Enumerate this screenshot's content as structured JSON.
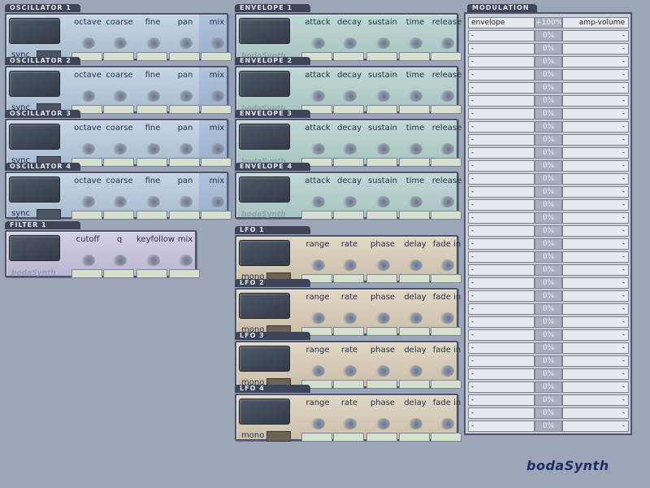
{
  "oscillators": [
    {
      "title": "OSCILLATOR 1",
      "sync_label": "sync",
      "knobs": [
        "octave",
        "coarse",
        "fine",
        "pan",
        "mix"
      ]
    },
    {
      "title": "OSCILLATOR 2",
      "sync_label": "sync",
      "knobs": [
        "octave",
        "coarse",
        "fine",
        "pan",
        "mix"
      ]
    },
    {
      "title": "OSCILLATOR 3",
      "sync_label": "sync",
      "knobs": [
        "octave",
        "coarse",
        "fine",
        "pan",
        "mix"
      ]
    },
    {
      "title": "OSCILLATOR 4",
      "sync_label": "sync",
      "knobs": [
        "octave",
        "coarse",
        "fine",
        "pan",
        "mix"
      ]
    }
  ],
  "envelopes": [
    {
      "title": "ENVELOPE 1",
      "knobs": [
        "attack",
        "decay",
        "sustain",
        "time",
        "release"
      ]
    },
    {
      "title": "ENVELOPE 2",
      "knobs": [
        "attack",
        "decay",
        "sustain",
        "time",
        "release"
      ]
    },
    {
      "title": "ENVELOPE 3",
      "knobs": [
        "attack",
        "decay",
        "sustain",
        "time",
        "release"
      ]
    },
    {
      "title": "ENVELOPE 4",
      "knobs": [
        "attack",
        "decay",
        "sustain",
        "time",
        "release"
      ]
    }
  ],
  "filter": {
    "title": "FILTER 1",
    "knobs": [
      "cutoff",
      "q",
      "keyfollow",
      "mix"
    ]
  },
  "lfos": [
    {
      "title": "LFO 1",
      "mono_label": "mono",
      "knobs": [
        "range",
        "rate",
        "phase",
        "delay",
        "fade in"
      ]
    },
    {
      "title": "LFO 2",
      "mono_label": "mono",
      "knobs": [
        "range",
        "rate",
        "phase",
        "delay",
        "fade in"
      ]
    },
    {
      "title": "LFO 3",
      "mono_label": "mono",
      "knobs": [
        "range",
        "rate",
        "phase",
        "delay",
        "fade in"
      ]
    },
    {
      "title": "LFO 4",
      "mono_label": "mono",
      "knobs": [
        "range",
        "rate",
        "phase",
        "delay",
        "fade in"
      ]
    }
  ],
  "modulation": {
    "title": "MODULATION",
    "rows": [
      {
        "source": "envelope",
        "amount": "+100%",
        "destination": "amp-volume"
      },
      {
        "source": "-",
        "amount": "0%",
        "destination": "-"
      },
      {
        "source": "-",
        "amount": "0%",
        "destination": "-"
      },
      {
        "source": "-",
        "amount": "0%",
        "destination": "-"
      },
      {
        "source": "-",
        "amount": "0%",
        "destination": "-"
      },
      {
        "source": "-",
        "amount": "0%",
        "destination": "-"
      },
      {
        "source": "-",
        "amount": "0%",
        "destination": "-"
      },
      {
        "source": "-",
        "amount": "0%",
        "destination": "-"
      },
      {
        "source": "-",
        "amount": "0%",
        "destination": "-"
      },
      {
        "source": "-",
        "amount": "0%",
        "destination": "-"
      },
      {
        "source": "-",
        "amount": "0%",
        "destination": "-"
      },
      {
        "source": "-",
        "amount": "0%",
        "destination": "-"
      },
      {
        "source": "-",
        "amount": "0%",
        "destination": "-"
      },
      {
        "source": "-",
        "amount": "0%",
        "destination": "-"
      },
      {
        "source": "-",
        "amount": "0%",
        "destination": "-"
      },
      {
        "source": "-",
        "amount": "0%",
        "destination": "-"
      },
      {
        "source": "-",
        "amount": "0%",
        "destination": "-"
      },
      {
        "source": "-",
        "amount": "0%",
        "destination": "-"
      },
      {
        "source": "-",
        "amount": "0%",
        "destination": "-"
      },
      {
        "source": "-",
        "amount": "0%",
        "destination": "-"
      },
      {
        "source": "-",
        "amount": "0%",
        "destination": "-"
      },
      {
        "source": "-",
        "amount": "0%",
        "destination": "-"
      },
      {
        "source": "-",
        "amount": "0%",
        "destination": "-"
      },
      {
        "source": "-",
        "amount": "0%",
        "destination": "-"
      },
      {
        "source": "-",
        "amount": "0%",
        "destination": "-"
      },
      {
        "source": "-",
        "amount": "0%",
        "destination": "-"
      },
      {
        "source": "-",
        "amount": "0%",
        "destination": "-"
      },
      {
        "source": "-",
        "amount": "0%",
        "destination": "-"
      },
      {
        "source": "-",
        "amount": "0%",
        "destination": "-"
      },
      {
        "source": "-",
        "amount": "0%",
        "destination": "-"
      },
      {
        "source": "-",
        "amount": "0%",
        "destination": "-"
      },
      {
        "source": "-",
        "amount": "0%",
        "destination": "-"
      }
    ]
  },
  "brand": "bodaSynth",
  "colors": {
    "background": "#9ca6b8",
    "tab": "#3f4558",
    "oscillator_panel": "#b8c9da",
    "envelope_panel": "#b4cfcb",
    "filter_panel": "#c8c4dc",
    "lfo_panel": "#d6ccb8",
    "brand": "#1f2c66"
  }
}
